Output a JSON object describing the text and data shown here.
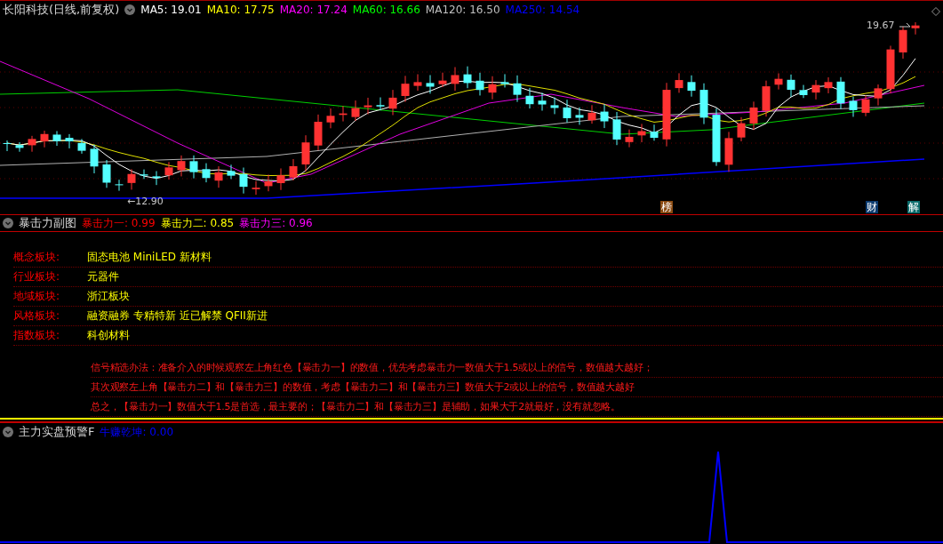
{
  "main_chart": {
    "title": "长阳科技(日线,前复权)",
    "moving_averages": [
      {
        "label": "MA5: 19.01",
        "color": "#ffffff"
      },
      {
        "label": "MA10: 17.75",
        "color": "#ffff00"
      },
      {
        "label": "MA20: 17.24",
        "color": "#ff00ff"
      },
      {
        "label": "MA60: 16.66",
        "color": "#00ff00"
      },
      {
        "label": "MA120: 16.50",
        "color": "#c0c0c0"
      },
      {
        "label": "MA250: 14.54",
        "color": "#0000ff"
      }
    ],
    "high_label": "19.67",
    "low_label": "←12.90",
    "markers": [
      {
        "text": "榜",
        "color": "#8b4a10"
      },
      {
        "text": "财",
        "color": "#0b3a6e"
      },
      {
        "text": "解",
        "color": "#0a6b6b"
      }
    ]
  },
  "sub_chart": {
    "title": "暴击力副图",
    "indicators": [
      {
        "label": "暴击力一: 0.99",
        "color": "#ff0000"
      },
      {
        "label": "暴击力二: 0.85",
        "color": "#ffff00"
      },
      {
        "label": "暴击力三: 0.96",
        "color": "#ff00ff"
      }
    ],
    "sectors": [
      {
        "label": "概念板块:",
        "value": "固态电池 MiniLED 新材料"
      },
      {
        "label": "行业板块:",
        "value": "元器件"
      },
      {
        "label": "地域板块:",
        "value": "浙江板块"
      },
      {
        "label": "风格板块:",
        "value": "融资融券 专精特新 近已解禁 QFII新进"
      },
      {
        "label": "指数板块:",
        "value": "科创材料"
      }
    ],
    "notes": [
      "信号精选办法：准备介入的时候观察左上角红色【暴击力一】的数值，优先考虑暴击力一数值大于1.5或以上的信号，数值越大越好；",
      "其次观察左上角【暴击力二】和【暴击力三】的数值，考虑【暴击力二】和【暴击力三】数值大于2或以上的信号，数值越大越好",
      "总之，【暴击力一】数值大于1.5是首选，最主要的；【暴击力二】和【暴击力三】是辅助，如果大于2就最好，没有就忽略。"
    ]
  },
  "alert_chart": {
    "title": "主力实盘预警F",
    "indicator": {
      "label": "牛赚乾坤: 0.00",
      "color": "#0000ff"
    }
  }
}
